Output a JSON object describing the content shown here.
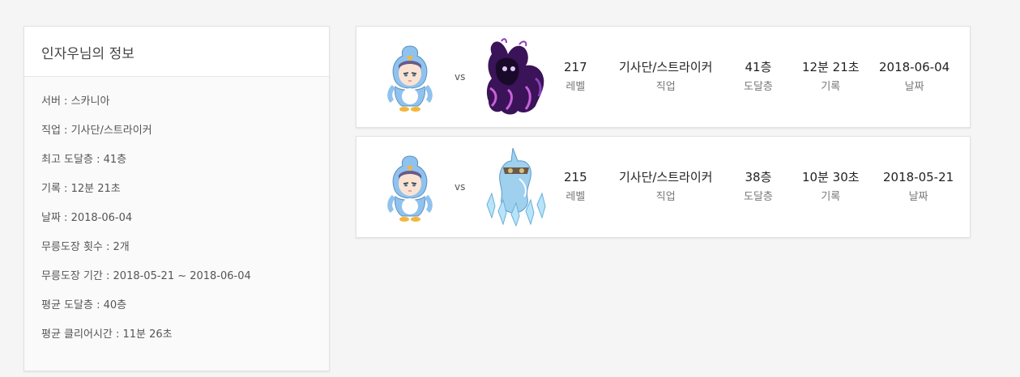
{
  "info": {
    "title": "인자우님의 정보",
    "items": [
      "서버 : 스카니아",
      "직업 : 기사단/스트라이커",
      "최고 도달층 : 41층",
      "기록 : 12분 21초",
      "날짜 : 2018-06-04",
      "무릉도장 횟수 : 2개",
      "무릉도장 기간 : 2018-05-21 ~ 2018-06-04",
      "평균 도달층 : 40층",
      "평균 클리어시간 : 11분 26초"
    ]
  },
  "records": [
    {
      "vs": "vs",
      "boss_icon": "dark-shadow-boss-icon",
      "level": "217",
      "level_label": "레벨",
      "job": "기사단/스트라이커",
      "job_label": "직업",
      "floor": "41층",
      "floor_label": "도달층",
      "time": "12분 21초",
      "time_label": "기록",
      "date": "2018-06-04",
      "date_label": "날짜"
    },
    {
      "vs": "vs",
      "boss_icon": "ice-unicorn-boss-icon",
      "level": "215",
      "level_label": "레벨",
      "job": "기사단/스트라이커",
      "job_label": "직업",
      "floor": "38층",
      "floor_label": "도달층",
      "time": "10분 30초",
      "time_label": "기록",
      "date": "2018-05-21",
      "date_label": "날짜"
    }
  ],
  "colors": {
    "background": "#f5f5f5",
    "penguin": "#8fc2ee",
    "shadow_boss": "#5a1f86",
    "ice_boss": "#9fd0ee"
  }
}
